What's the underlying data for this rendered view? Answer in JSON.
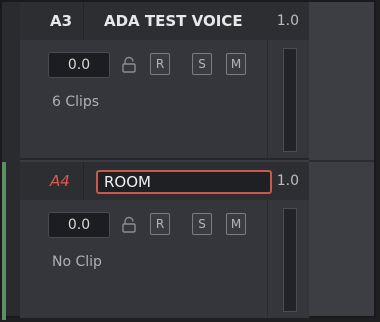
{
  "tracks": [
    {
      "id": "A3",
      "name": "ADA TEST VOICE",
      "level": "1.0",
      "volume": "0.0",
      "buttons": {
        "r": "R",
        "s": "S",
        "m": "M"
      },
      "clip_info": "6 Clips"
    },
    {
      "id": "A4",
      "name": "ROOM",
      "level": "1.0",
      "volume": "0.0",
      "buttons": {
        "r": "R",
        "s": "S",
        "m": "M"
      },
      "clip_info": "No Clip"
    }
  ],
  "colors": {
    "track_selected_red": "#e0584f",
    "name_field_border": "#c7594e",
    "accent_green": "#5d8f63"
  }
}
